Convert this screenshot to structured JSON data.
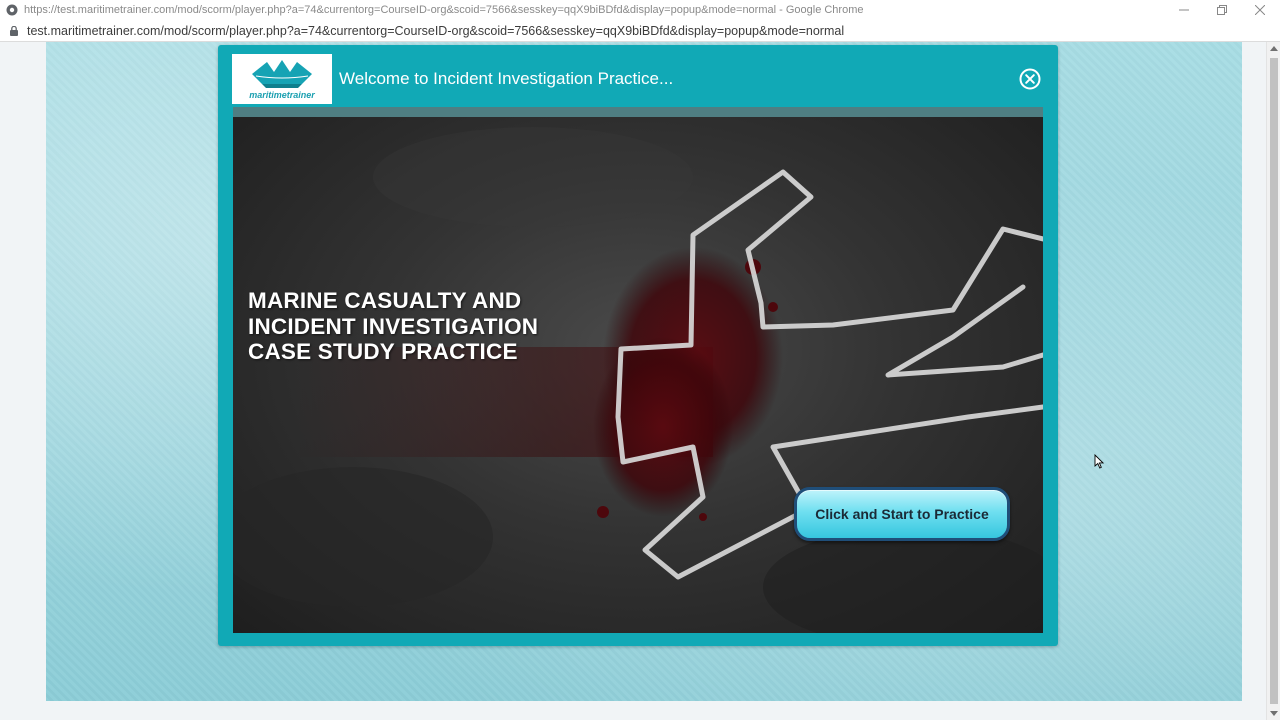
{
  "browser": {
    "window_title": "https://test.maritimetrainer.com/mod/scorm/player.php?a=74&currentorg=CourseID-org&scoid=7566&sesskey=qqX9biBDfd&display=popup&mode=normal - Google Chrome",
    "url": "test.maritimetrainer.com/mod/scorm/player.php?a=74&currentorg=CourseID-org&scoid=7566&sesskey=qqX9biBDfd&display=popup&mode=normal",
    "icons": {
      "favicon": "chrome-globe-icon",
      "lock": "lock-icon",
      "minimize": "minimize-icon",
      "restore": "restore-icon",
      "close": "close-icon"
    }
  },
  "player": {
    "logo_text": "maritimetrainer",
    "header_title": "Welcome to Incident Investigation Practice...",
    "close_icon": "circle-close-icon",
    "accent_color": "#11a9b6"
  },
  "slide": {
    "title_lines": [
      "MARINE CASUALTY AND",
      "INCIDENT INVESTIGATION",
      "CASE STUDY PRACTICE"
    ],
    "start_button_label": "Click and Start to Practice"
  }
}
